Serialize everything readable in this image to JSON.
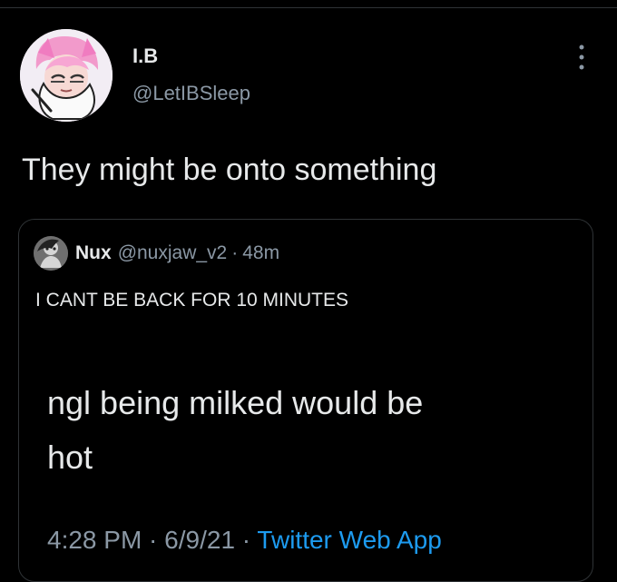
{
  "tweet": {
    "author": {
      "name": "I.B",
      "handle": "@LetIBSleep",
      "avatar_icon": "anime-avatar-icon"
    },
    "text": "They might be onto something",
    "more_icon": "more-options-icon"
  },
  "quoted_tweet": {
    "author": {
      "name": "Nux",
      "handle": "@nuxjaw_v2",
      "avatar_icon": "quoted-avatar-icon"
    },
    "separator": "·",
    "time": "48m",
    "text": "I CANT BE BACK FOR 10 MINUTES"
  },
  "caption": {
    "line1": "ngl being milked would be",
    "line2": "hot"
  },
  "meta": {
    "time": "4:28 PM",
    "separator1": " · ",
    "date": "6/9/21",
    "separator2": " · ",
    "source": "Twitter Web App"
  },
  "colors": {
    "background": "#000000",
    "text": "#e7e9ea",
    "muted": "#8b98a5",
    "accent": "#1d9bf0",
    "border": "#2f3336"
  }
}
